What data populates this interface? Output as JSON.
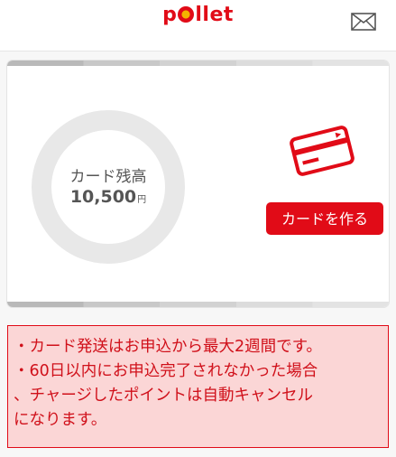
{
  "header": {
    "logo_text": "pollet",
    "mail_icon": "mail-icon"
  },
  "card_panel": {
    "balance_label": "カード残高",
    "balance_value": "10,500",
    "balance_unit": "円",
    "card_icon": "credit-card-icon",
    "make_card_button": "カードを作る"
  },
  "notice": {
    "lines": [
      "・カード発送はお申込から最大2週間です。",
      "・60日以内にお申込完了されなかった場合",
      "、チャージしたポイントは自動キャンセル",
      "になります。"
    ]
  },
  "colors": {
    "brand_red": "#e10b17",
    "notice_bg": "#fbd6d6",
    "ring_gray": "#e8e8e8"
  }
}
